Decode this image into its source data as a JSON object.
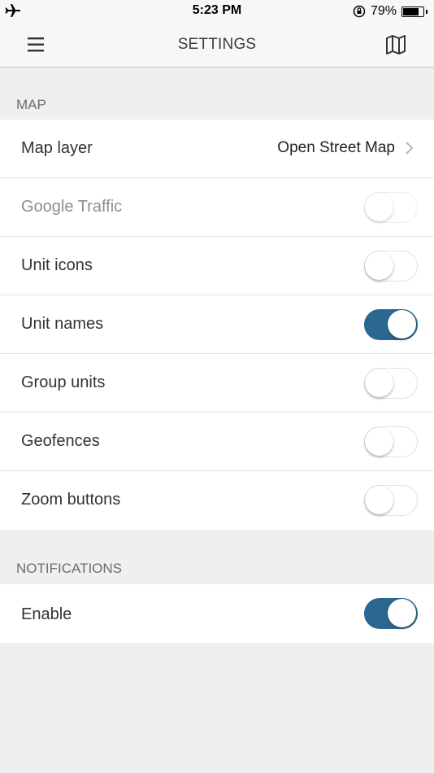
{
  "status_bar": {
    "time": "5:23 PM",
    "battery_percent": "79%",
    "battery_level": 0.79,
    "icons": [
      "airplane-icon",
      "orientation-lock-icon",
      "battery-icon"
    ]
  },
  "nav": {
    "title": "SETTINGS",
    "left_icon": "menu-icon",
    "right_icon": "map-icon"
  },
  "sections": {
    "map": {
      "header": "MAP",
      "map_layer": {
        "label": "Map layer",
        "value": "Open Street Map"
      },
      "google_traffic": {
        "label": "Google Traffic",
        "enabled": false,
        "on": false
      },
      "unit_icons": {
        "label": "Unit icons",
        "on": false
      },
      "unit_names": {
        "label": "Unit names",
        "on": true
      },
      "group_units": {
        "label": "Group units",
        "on": false
      },
      "geofences": {
        "label": "Geofences",
        "on": false
      },
      "zoom_buttons": {
        "label": "Zoom buttons",
        "on": false
      }
    },
    "notifications": {
      "header": "NOTIFICATIONS",
      "enable": {
        "label": "Enable",
        "on": true
      }
    }
  },
  "colors": {
    "toggle_on": "#2b6891",
    "background": "#efeff0",
    "disabled_text": "#8e8e93"
  }
}
